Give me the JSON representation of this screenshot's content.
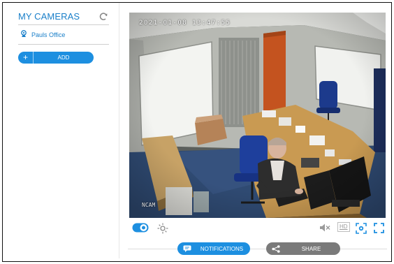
{
  "sidebar": {
    "title": "MY CAMERAS",
    "refresh_icon": "refresh-icon",
    "cameras": [
      {
        "label": "Pauls Office",
        "icon": "camera-icon"
      }
    ],
    "add_button": {
      "plus": "+",
      "label": "ADD"
    }
  },
  "video": {
    "timestamp": "2021-01-08 13:47:55",
    "watermark": "NCAM"
  },
  "controls": {
    "toggle_state": "on",
    "mute_icon": "mute-icon",
    "hd_label": "HD",
    "snapshot_icon": "snapshot-icon",
    "fullscreen_icon": "fullscreen-icon",
    "brightness_icon": "brightness-icon"
  },
  "actions": {
    "notifications_label": "NOTIFICATIONS",
    "share_label": "SHARE"
  },
  "colors": {
    "accent": "#1d8fe0",
    "text_blue": "#1a7fc9",
    "share_gray": "#7a7a7a"
  }
}
